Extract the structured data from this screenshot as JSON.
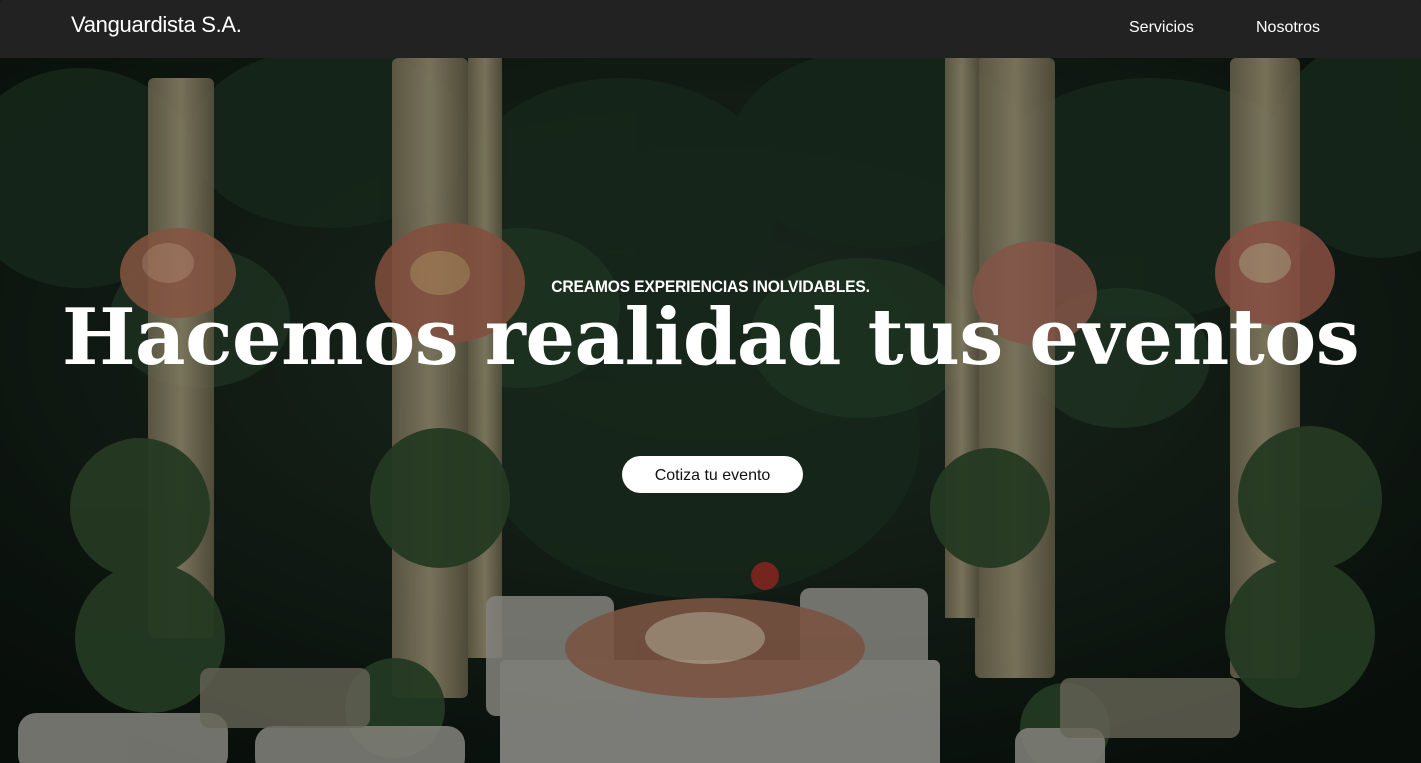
{
  "navbar": {
    "brand": "Vanguardista S.A.",
    "links": [
      {
        "label": "Servicios"
      },
      {
        "label": "Nosotros"
      }
    ]
  },
  "hero": {
    "tagline": "CREAMOS EXPERIENCIAS INOLVIDABLES.",
    "headline": "Hacemos realidad tus eventos",
    "cta_label": "Cotiza tu evento",
    "background_description_icon": "garden-wedding-photo"
  },
  "colors": {
    "navbar_bg": "#222222",
    "text": "#ffffff",
    "button_bg": "#ffffff",
    "button_text": "#111111"
  }
}
